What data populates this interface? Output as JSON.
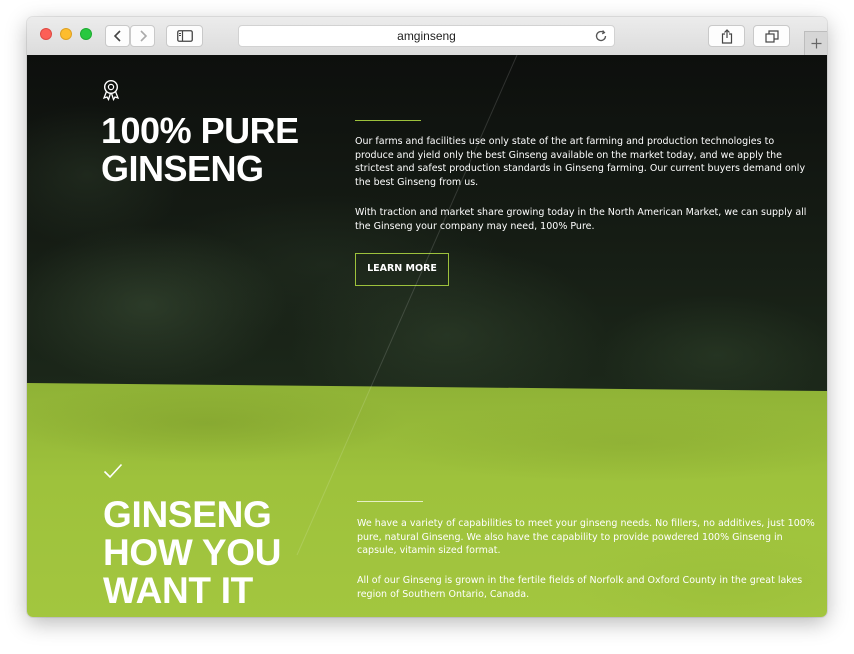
{
  "browser": {
    "url": "amginseng",
    "icons": {
      "back": "chevron-left-icon",
      "forward": "chevron-right-icon",
      "sidebar": "sidebar-icon",
      "reload": "reload-icon",
      "share": "share-icon",
      "tabs": "tabs-icon",
      "new_tab": "plus-icon"
    }
  },
  "section_pure": {
    "icon": "award-ribbon-icon",
    "title_line1": "100% PURE",
    "title_line2": "GINSENG",
    "paragraph1": "Our farms and facilities use only state of the art farming and production technologies to produce and yield only the best Ginseng available on the market today, and we apply the strictest and safest production standards in Ginseng farming. Our current buyers demand only the best Ginseng from us.",
    "paragraph2": "With traction and market share growing today in the North American Market, we can supply all the Ginseng your company may need, 100% Pure.",
    "button_label": "LEARN MORE"
  },
  "section_how": {
    "icon": "checkmark-icon",
    "title_line1": "GINSENG",
    "title_line2": "HOW YOU",
    "title_line3": "WANT IT",
    "paragraph1": "We have a variety of capabilities to meet your ginseng needs. No fillers, no additives, just 100% pure, natural Ginseng. We also have the capability to provide powdered 100% Ginseng in capsule, vitamin sized format.",
    "paragraph2": "All of our Ginseng is grown in the fertile fields of Norfolk and Oxford County in the great lakes region of Southern Ontario, Canada."
  },
  "colors": {
    "accent_green": "#9dc13c",
    "dark_bg": "#111411",
    "text": "#ffffff"
  }
}
